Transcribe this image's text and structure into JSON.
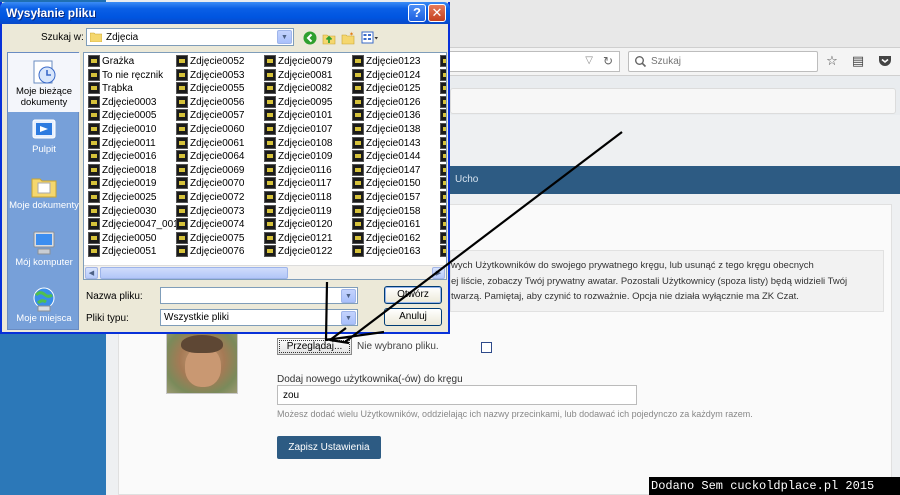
{
  "dialog": {
    "title": "Wysyłanie pliku",
    "lookin_label": "Szukaj w:",
    "lookin_value": "Zdjęcia",
    "places": [
      "Moje bieżące dokumenty",
      "Pulpit",
      "Moje dokumenty",
      "Mój komputer",
      "Moje miejsca"
    ],
    "files_col1": [
      "Grażka",
      "To nie ręcznik",
      "Trąbka",
      "Zdjęcie0003",
      "Zdjęcie0005",
      "Zdjęcie0010",
      "Zdjęcie0011",
      "Zdjęcie0016",
      "Zdjęcie0018",
      "Zdjęcie0019",
      "Zdjęcie0025",
      "Zdjęcie0030",
      "Zdjęcie0047_001",
      "Zdjęcie0050",
      "Zdjęcie0051"
    ],
    "files_col2": [
      "Zdjęcie0052",
      "Zdjęcie0053",
      "Zdjęcie0055",
      "Zdjęcie0056",
      "Zdjęcie0057",
      "Zdjęcie0060",
      "Zdjęcie0061",
      "Zdjęcie0064",
      "Zdjęcie0069",
      "Zdjęcie0070",
      "Zdjęcie0072",
      "Zdjęcie0073",
      "Zdjęcie0074",
      "Zdjęcie0075",
      "Zdjęcie0076"
    ],
    "files_col3": [
      "Zdjęcie0079",
      "Zdjęcie0081",
      "Zdjęcie0082",
      "Zdjęcie0095",
      "Zdjęcie0101",
      "Zdjęcie0107",
      "Zdjęcie0108",
      "Zdjęcie0109",
      "Zdjęcie0116",
      "Zdjęcie0117",
      "Zdjęcie0118",
      "Zdjęcie0119",
      "Zdjęcie0120",
      "Zdjęcie0121",
      "Zdjęcie0122"
    ],
    "files_col4": [
      "Zdjęcie0123",
      "Zdjęcie0124",
      "Zdjęcie0125",
      "Zdjęcie0126",
      "Zdjęcie0136",
      "Zdjęcie0138",
      "Zdjęcie0143",
      "Zdjęcie0144",
      "Zdjęcie0147",
      "Zdjęcie0150",
      "Zdjęcie0157",
      "Zdjęcie0158",
      "Zdjęcie0161",
      "Zdjęcie0162",
      "Zdjęcie0163"
    ],
    "filename_label": "Nazwa pliku:",
    "filename_value": "",
    "filetype_label": "Pliki typu:",
    "filetype_value": "Wszystkie pliki",
    "open_button": "Otwórz",
    "cancel_button": "Anuluj"
  },
  "browser": {
    "search_placeholder": "Szukaj",
    "nav_item": "Ucho"
  },
  "page": {
    "info_line1": "wych Użytkowników do swojego prywatnego kręgu, lub usunąć z tego kręgu obecnych",
    "info_line2": "ej liście, zobaczy Twój prywatny awatar. Pozostali Użytkownicy (spoza listy) będą widzieli Twój",
    "info_line3": "twarzą. Pamiętaj, aby czynić to rozważnie. Opcja nie działa wyłącznie ma ZK Czat.",
    "browse_button": "Przeglądaj...",
    "no_file_text": "Nie wybrano pliku.",
    "add_label": "Dodaj nowego użytkownika(-ów) do kręgu",
    "add_value": "zou",
    "hint": "Możesz dodać wielu Użytkowników, oddzielając ich nazwy przecinkami, lub dodawać ich pojedynczo za każdym razem.",
    "save_button": "Zapisz Ustawienia"
  },
  "watermark": "Dodano Sem cuckoldplace.pl 2015"
}
